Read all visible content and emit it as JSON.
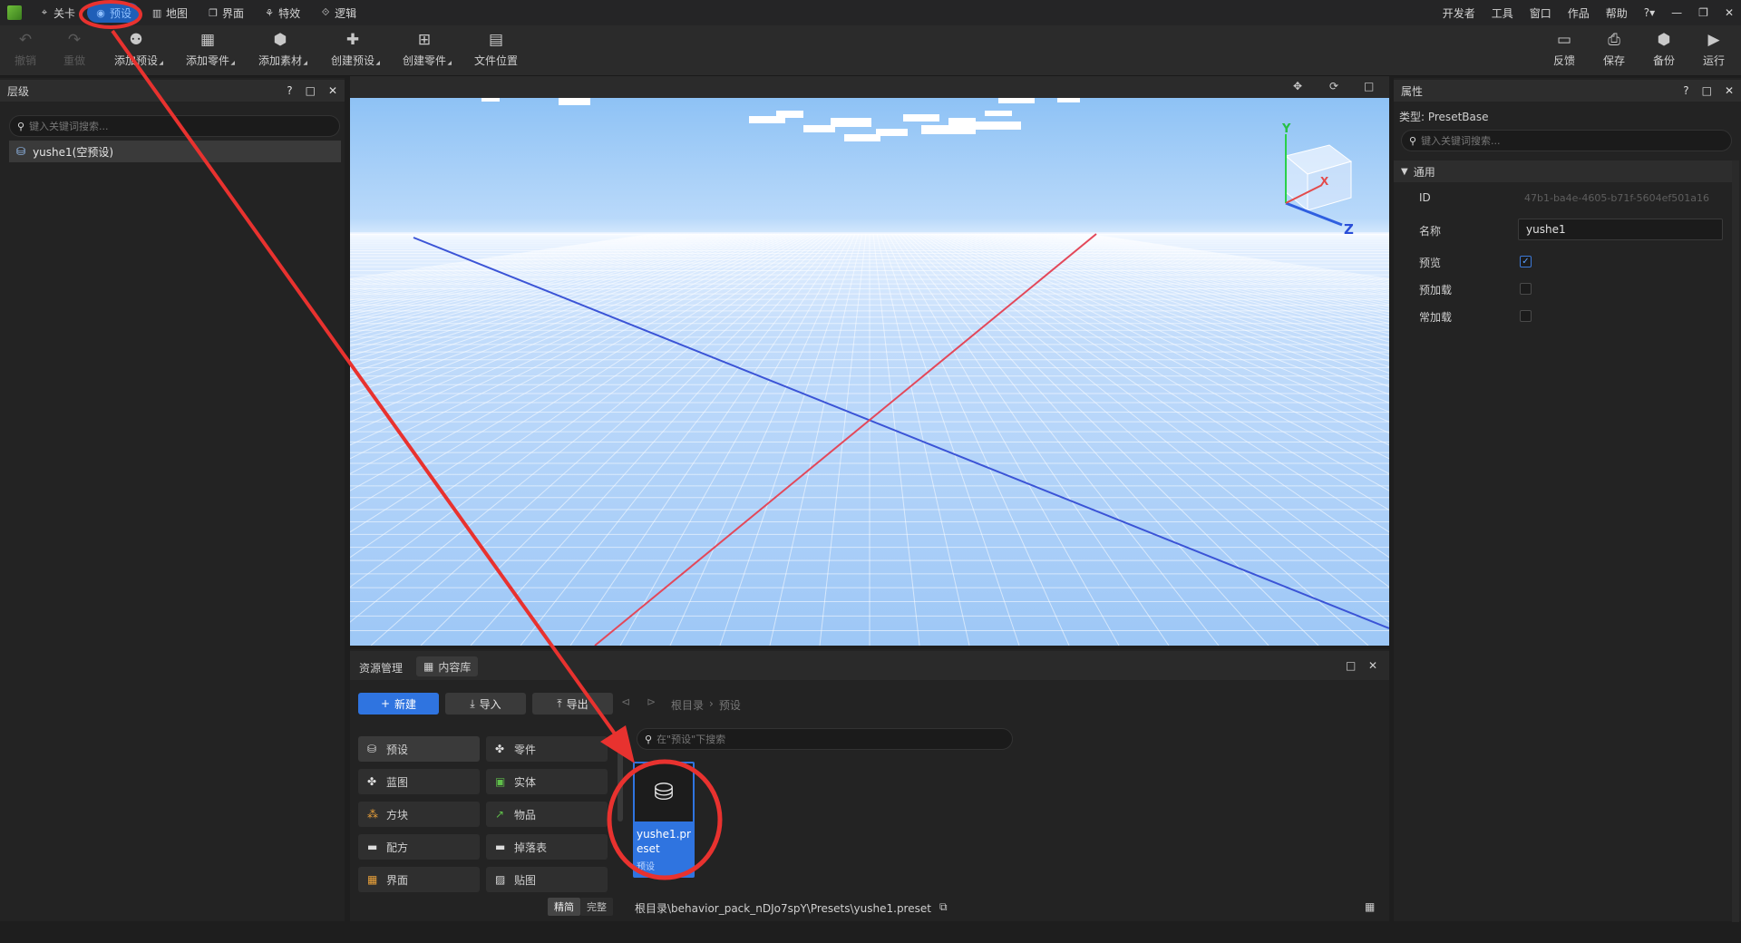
{
  "menu": {
    "items": [
      {
        "label": "关卡",
        "icon": "target-icon"
      },
      {
        "label": "预设",
        "icon": "eye-icon",
        "active": true
      },
      {
        "label": "地图",
        "icon": "map-bars-icon"
      },
      {
        "label": "界面",
        "icon": "window-icon"
      },
      {
        "label": "特效",
        "icon": "effects-icon"
      },
      {
        "label": "逻辑",
        "icon": "logic-icon"
      }
    ],
    "right": [
      "开发者",
      "工具",
      "窗口",
      "作品",
      "帮助",
      "?▾",
      "—",
      "❐",
      "✕"
    ]
  },
  "toolbar": {
    "undo": "撤销",
    "redo": "重做",
    "tools": [
      "添加预设",
      "添加零件",
      "添加素材",
      "创建预设",
      "创建零件",
      "文件位置"
    ],
    "right": [
      "反馈",
      "保存",
      "备份",
      "运行"
    ]
  },
  "hierarchy": {
    "title": "层级",
    "search_placeholder": "键入关键词搜索...",
    "items": [
      {
        "label": "yushe1(空预设)"
      }
    ]
  },
  "viewport": {
    "axis_labels": {
      "y": "Y",
      "z": "Z",
      "x": "X"
    }
  },
  "properties": {
    "title": "属性",
    "type_label": "类型: PresetBase",
    "search_placeholder": "键入关键词搜索...",
    "section": "通用",
    "fields": [
      {
        "label": "ID",
        "value": "47b1-ba4e-4605-b71f-5604ef501a16"
      },
      {
        "label": "名称",
        "value": "yushe1"
      },
      {
        "label": "预览",
        "checked": true
      },
      {
        "label": "预加载",
        "checked": false
      },
      {
        "label": "常加载",
        "checked": false
      }
    ]
  },
  "assets": {
    "tabs": [
      "资源管理",
      "内容库"
    ],
    "new_label": "新建",
    "import_label": "导入",
    "export_label": "导出",
    "breadcrumb": [
      "根目录",
      "预设"
    ],
    "search_placeholder": "在\"预设\"下搜索",
    "categories": [
      {
        "label": "预设",
        "icon": "preset-icon"
      },
      {
        "label": "零件",
        "icon": "puzzle-icon"
      },
      {
        "label": "蓝图",
        "icon": "blueprint-icon"
      },
      {
        "label": "实体",
        "icon": "entity-icon"
      },
      {
        "label": "方块",
        "icon": "block-icon"
      },
      {
        "label": "物品",
        "icon": "item-icon"
      },
      {
        "label": "配方",
        "icon": "folder-icon"
      },
      {
        "label": "掉落表",
        "icon": "folder-icon"
      },
      {
        "label": "界面",
        "icon": "ui-icon"
      },
      {
        "label": "贴图",
        "icon": "texture-icon"
      }
    ],
    "file": {
      "name": "yushe1.preset",
      "tag": "预设"
    },
    "view_modes": [
      "精简",
      "完整"
    ],
    "path": "根目录\\behavior_pack_nDJo7spY\\Presets\\yushe1.preset"
  }
}
